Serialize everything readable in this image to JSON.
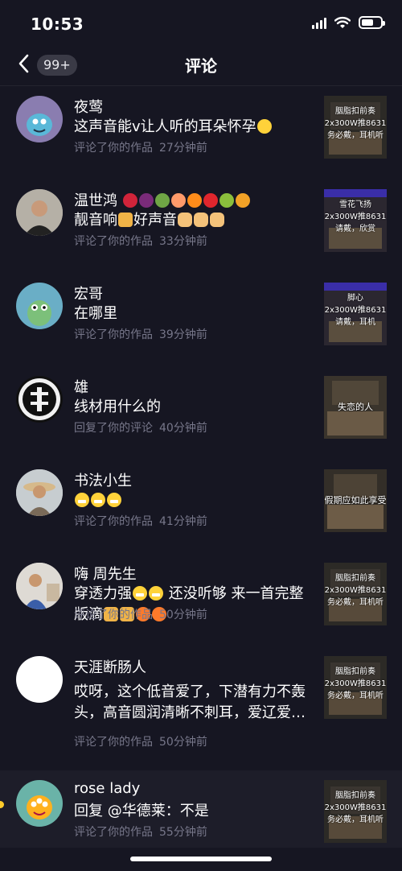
{
  "status": {
    "time": "10:53"
  },
  "nav": {
    "badge": "99+",
    "title": "评论"
  },
  "comments": [
    {
      "name": "夜莺",
      "text": "这声音能v让人听的耳朵怀孕",
      "action": "评论了你的作品",
      "time": "27分钟前",
      "thumb": "胭脂扣前奏\n2x300W推8631\n务必戴，耳机听"
    },
    {
      "name": "温世鸿",
      "text": "靓音响",
      "text2": "好声音",
      "action": "评论了你的作品",
      "time": "33分钟前",
      "thumb": "雪花飞扬\n2x300W推8631\n请戴，欣赏"
    },
    {
      "name": "宏哥",
      "text": "在哪里",
      "action": "评论了你的作品",
      "time": "39分钟前",
      "thumb": "脚心\n2x300W推8631\n请戴，耳机"
    },
    {
      "name": "雄",
      "text": "线材用什么的",
      "action": "回复了你的评论",
      "time": "40分钟前",
      "thumb": "失恋的人"
    },
    {
      "name": "书法小生",
      "text": "",
      "action": "评论了你的作品",
      "time": "41分钟前",
      "thumb": "假期应如此享受"
    },
    {
      "name": "嗨 周先生",
      "text": "穿透力强",
      "text2": "还没听够 来一首完整版滴",
      "action": "评论了你的作品",
      "time": "50分钟前",
      "thumb": "胭脂扣前奏\n2x300W推8631\n务必戴，耳机听"
    },
    {
      "name": "天涯断肠人",
      "text": "哎呀，这个低音爱了，下潜有力不轰头，高音圆润清晰不刺耳，爱辽爱…",
      "action": "评论了你的作品",
      "time": "50分钟前",
      "thumb": "胭脂扣前奏\n2x300W推8631\n务必戴，耳机听"
    },
    {
      "name": "rose lady",
      "text": "回复 @华德莱：不是",
      "action": "评论了你的作品",
      "time": "55分钟前",
      "thumb": "胭脂扣前奏\n2x300W推8631\n务必戴，耳机听"
    }
  ]
}
